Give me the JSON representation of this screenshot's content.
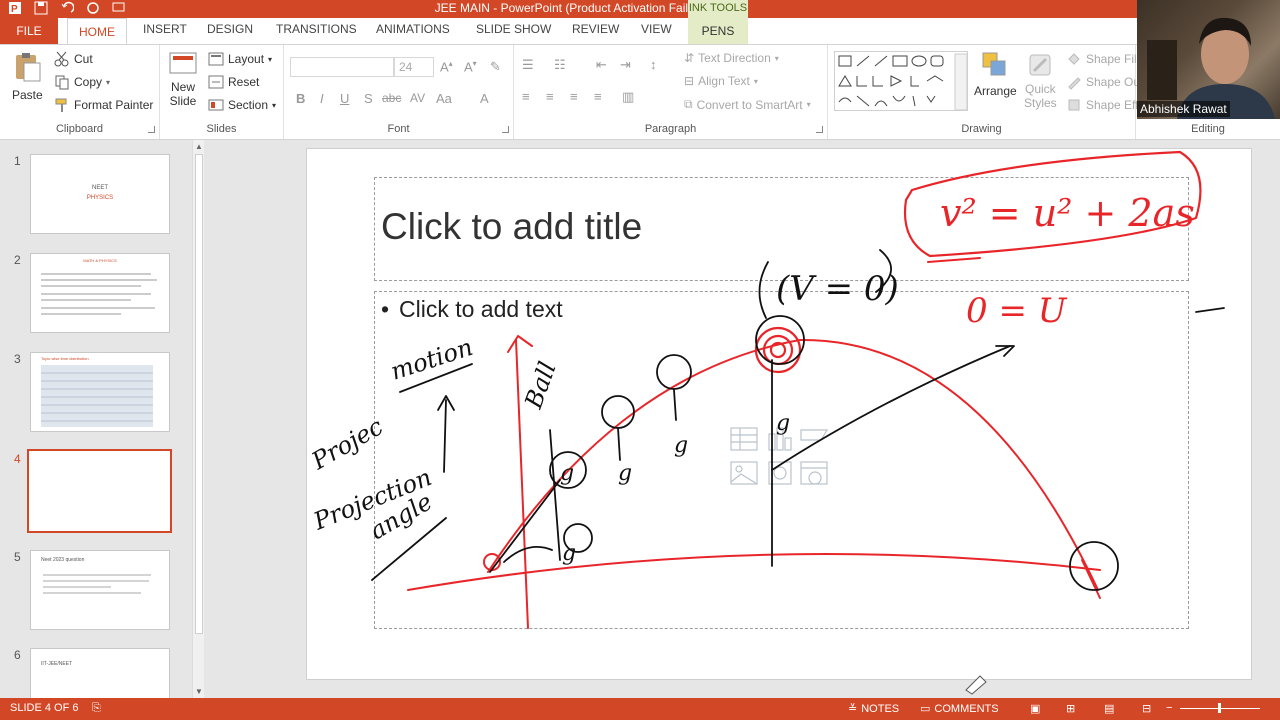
{
  "app": {
    "window_title": "JEE MAIN -  PowerPoint (Product Activation Failed)",
    "contextual_header": "INK TOOLS"
  },
  "tabs": [
    "FILE",
    "HOME",
    "INSERT",
    "DESIGN",
    "TRANSITIONS",
    "ANIMATIONS",
    "SLIDE SHOW",
    "REVIEW",
    "VIEW",
    "PENS"
  ],
  "ribbon": {
    "clipboard": {
      "label": "Clipboard",
      "paste": "Paste",
      "cut": "Cut",
      "copy": "Copy",
      "format_painter": "Format Painter"
    },
    "slides": {
      "label": "Slides",
      "new_slide_1": "New",
      "new_slide_2": "Slide",
      "layout": "Layout",
      "reset": "Reset",
      "section": "Section"
    },
    "font": {
      "label": "Font",
      "font_name": "",
      "font_size": "24",
      "bold": "B",
      "italic": "I",
      "underline": "U",
      "shadow": "S",
      "strike": "abc",
      "spacing": "AV",
      "case": "Aa",
      "color": "A"
    },
    "paragraph": {
      "label": "Paragraph",
      "text_direction": "Text Direction",
      "align_text": "Align Text",
      "convert_smartart": "Convert to SmartArt"
    },
    "drawing": {
      "label": "Drawing",
      "arrange": "Arrange",
      "quick_1": "Quick",
      "quick_2": "Styles",
      "shape_fill": "Shape Fill",
      "shape_outline": "Shape Ou",
      "shape_effects": "Shape Eff"
    },
    "editing": {
      "label": "Editing"
    }
  },
  "webcam": {
    "name": "Abhishek Rawat"
  },
  "slides_pane": {
    "slides": [
      {
        "num": "1",
        "line1": "NEET",
        "line2": "PHYSICS"
      },
      {
        "num": "2",
        "heading": "MATH & PHYSICS"
      },
      {
        "num": "3",
        "heading": "Topic wise time distribution"
      },
      {
        "num": "4"
      },
      {
        "num": "5",
        "heading": "Neet 2023 question"
      },
      {
        "num": "6",
        "heading": "IIT-JEE/NEET"
      }
    ]
  },
  "slide": {
    "title_placeholder": "Click to add title",
    "body_placeholder": "Click to add text",
    "bullet": "•",
    "ink_text": {
      "formula": "v² = u² + 2as",
      "v_equals_zero": "(V = 0)",
      "zero_equals_u": "0 = U",
      "motion": "motion",
      "projectile": "Projec",
      "projection": "Projection",
      "angle": "angle",
      "ball": "Ball"
    }
  },
  "statusbar": {
    "slide_counter": "SLIDE 4 OF 6",
    "notes": "NOTES",
    "comments": "COMMENTS"
  },
  "colors": {
    "accent": "#d24726",
    "ink_red": "#e8262a",
    "ink_black": "#111111"
  }
}
